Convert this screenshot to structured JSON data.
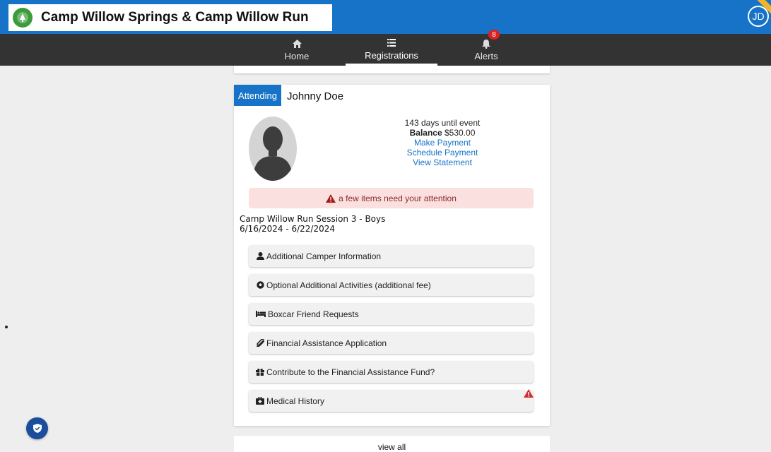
{
  "header": {
    "app_title": "Camp Willow Springs & Camp Willow Run",
    "user_initials": "JD",
    "logo_icon": "camp-logo-icon",
    "bar_color": "#1673c7"
  },
  "nav": {
    "items": [
      {
        "label": "Home",
        "icon": "home-icon"
      },
      {
        "label": "Registrations",
        "icon": "list-icon"
      },
      {
        "label": "Alerts",
        "icon": "bell-icon",
        "badge": "8"
      }
    ],
    "active": "Registrations"
  },
  "registration": {
    "status": "Attending",
    "camper_name": "Johnny Doe",
    "days_until": "143 days until event",
    "balance_label": "Balance",
    "balance_value": "$530.00",
    "links": [
      "Make Payment",
      "Schedule Payment",
      "View Statement"
    ],
    "alert_text": "a few items need your attention",
    "session_name": "Camp Willow Run Session 3 - Boys",
    "session_dates": "6/16/2024 - 6/22/2024",
    "items": [
      {
        "label": "Additional Camper Information",
        "icon": "user-icon"
      },
      {
        "label": "Optional Additional Activities (additional fee)",
        "icon": "soccer-ball-icon"
      },
      {
        "label": "Boxcar Friend Requests",
        "icon": "bed-icon"
      },
      {
        "label": "Financial Assistance Application",
        "icon": "paperclip-icon"
      },
      {
        "label": "Contribute to the Financial Assistance Fund?",
        "icon": "gift-icon"
      },
      {
        "label": "Medical History",
        "icon": "medical-kit-icon",
        "warning": true
      }
    ]
  },
  "footer": {
    "view_all": "view all"
  },
  "colors": {
    "accent": "#1673c7",
    "alert_bg": "#fbe0e0",
    "warning": "#d32f2f",
    "navbar": "#333333"
  }
}
